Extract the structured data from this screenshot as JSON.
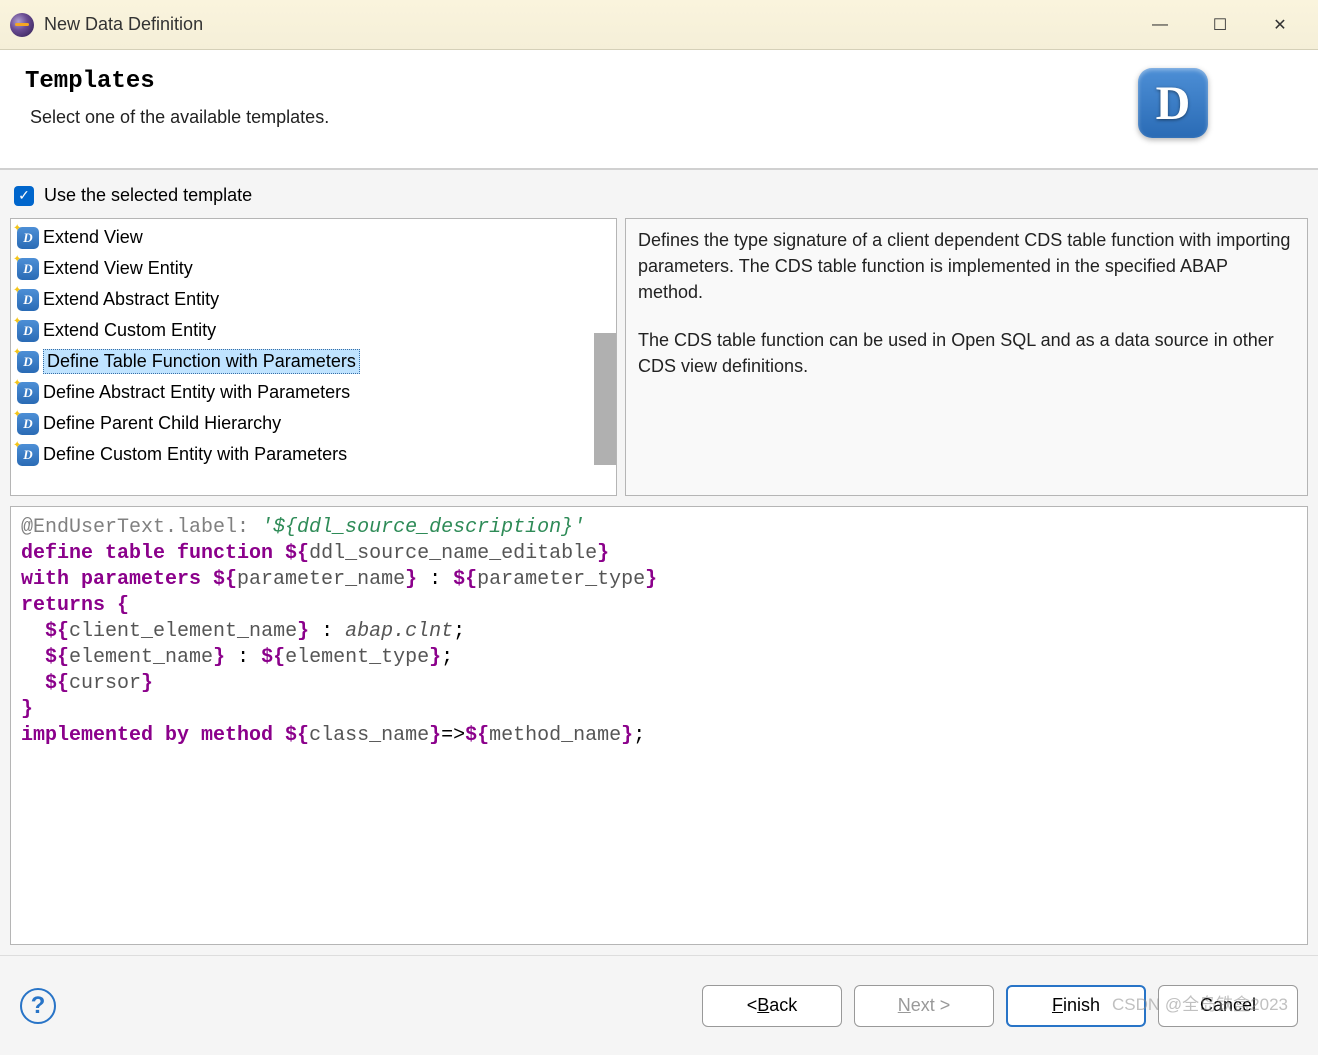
{
  "window": {
    "title": "New Data Definition"
  },
  "header": {
    "title": "Templates",
    "subtitle": "Select one of the available templates."
  },
  "checkbox": {
    "checked": true,
    "label": "Use the selected template"
  },
  "templates": [
    {
      "label": "Extend View",
      "selected": false
    },
    {
      "label": "Extend View Entity",
      "selected": false
    },
    {
      "label": "Extend Abstract Entity",
      "selected": false
    },
    {
      "label": "Extend Custom Entity",
      "selected": false
    },
    {
      "label": "Define Table Function with Parameters",
      "selected": true
    },
    {
      "label": "Define Abstract Entity with Parameters",
      "selected": false
    },
    {
      "label": "Define Parent Child Hierarchy",
      "selected": false
    },
    {
      "label": "Define Custom Entity with Parameters",
      "selected": false
    }
  ],
  "description": {
    "p1": "Defines the type signature of a client dependent CDS table function with importing parameters. The CDS table function is implemented in the specified ABAP method.",
    "p2": "The CDS table function can be used in Open SQL and as a data source in other CDS view definitions."
  },
  "code": {
    "line1_ann": "@EndUserText.label: ",
    "line1_str": "'${ddl_source_description}'",
    "line2_kw": "define table function ",
    "line2_var": "ddl_source_name_editable",
    "line3_kw": "with parameters ",
    "line3_var1": "parameter_name",
    "line3_var2": "parameter_type",
    "line4_kw": "returns ",
    "line5_var": "client_element_name",
    "line5_type": "abap.clnt",
    "line6_var1": "element_name",
    "line6_var2": "element_type",
    "line7_var": "cursor",
    "line9_kw": "implemented by method ",
    "line9_var1": "class_name",
    "line9_var2": "method_name"
  },
  "buttons": {
    "back": "< Back",
    "next": "Next >",
    "finish": "Finish",
    "cancel": "Cancel",
    "back_key": "B",
    "next_key": "N",
    "finish_key": "F"
  },
  "watermark": "CSDN @全岛铁盒2023"
}
